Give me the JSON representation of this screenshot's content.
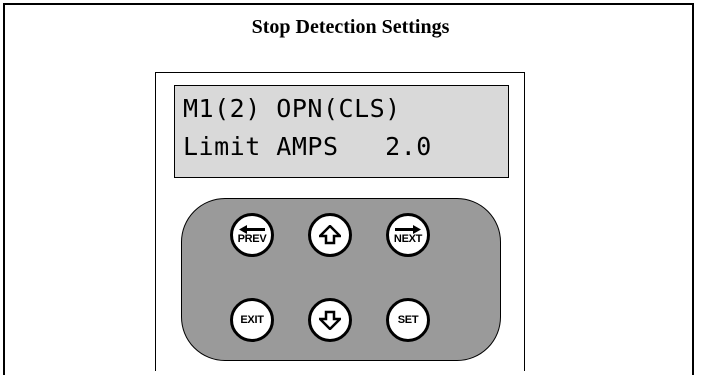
{
  "title": "Stop Detection Settings",
  "lcd": {
    "line1": "M1(2) OPN(CLS)",
    "line2": "Limit AMPS   2.0",
    "background": "#d9d9d9"
  },
  "keypad": {
    "background": "#9a9a9a",
    "keys": {
      "prev": {
        "label": "PREV",
        "icon": "arrow-left-icon"
      },
      "up": {
        "icon": "arrow-up-icon"
      },
      "next": {
        "label": "NEXT",
        "icon": "arrow-right-icon"
      },
      "exit": {
        "label": "EXIT"
      },
      "down": {
        "icon": "arrow-down-icon"
      },
      "set": {
        "label": "SET"
      }
    }
  }
}
